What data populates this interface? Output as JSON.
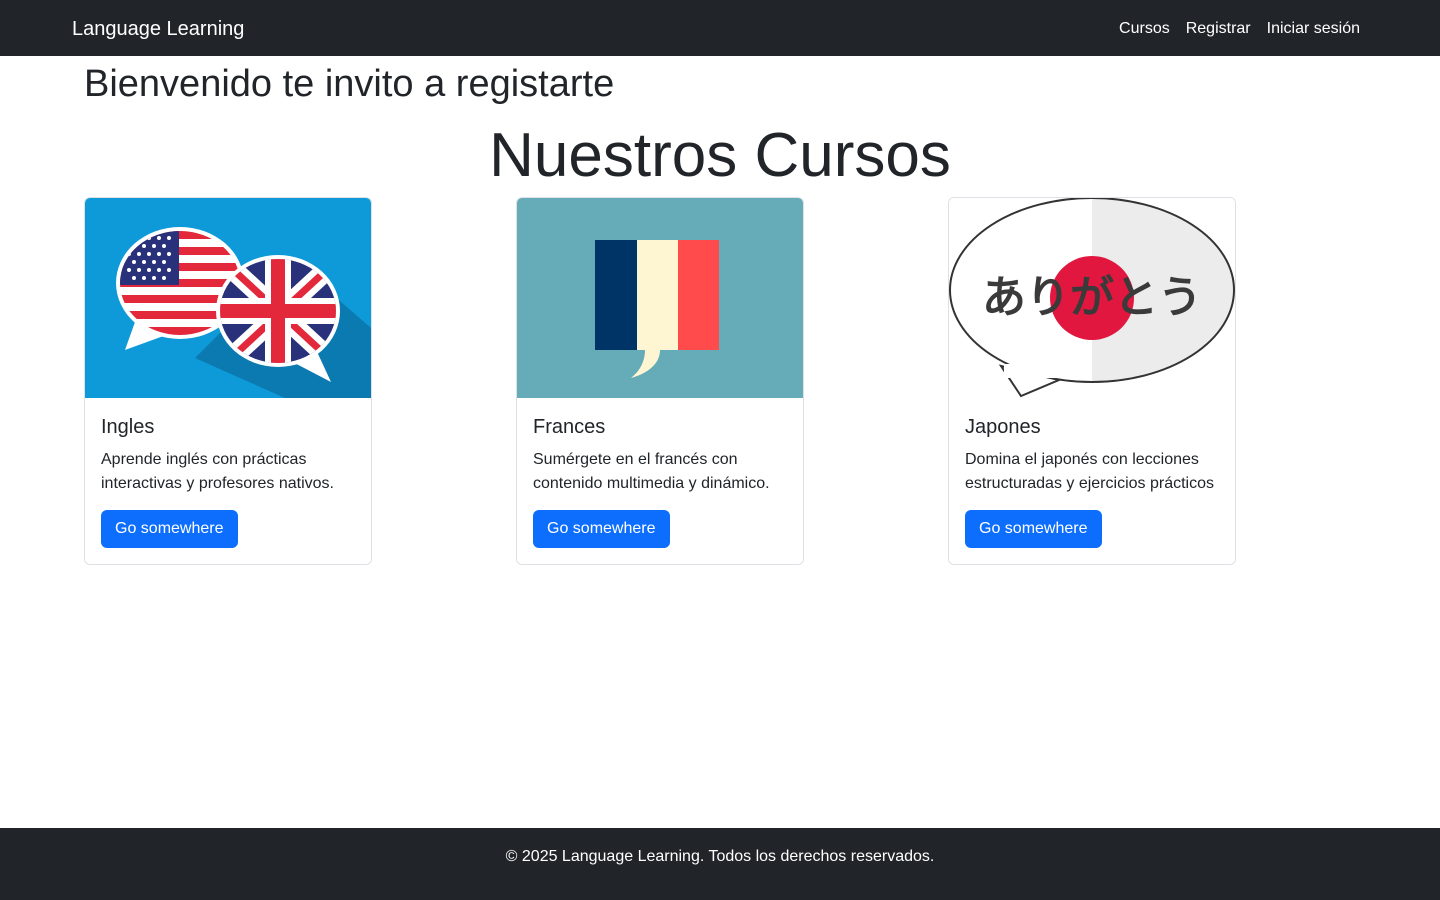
{
  "navbar": {
    "brand": "Language Learning",
    "links": [
      "Cursos",
      "Registrar",
      "Iniciar sesión"
    ]
  },
  "hero": {
    "welcome": "Bienvenido te invito a registarte",
    "section_title": "Nuestros Cursos"
  },
  "courses": [
    {
      "title": "Ingles",
      "text": "Aprende inglés con prácticas interactivas y profesores nativos.",
      "button": "Go somewhere",
      "image_icon": "us-uk-flag-speech-bubbles-icon"
    },
    {
      "title": "Frances",
      "text": "Sumérgete en el francés con contenido multimedia y dinámico.",
      "button": "Go somewhere",
      "image_icon": "french-flag-speech-bubble-icon"
    },
    {
      "title": "Japones",
      "text": "Domina el japonés con lecciones estructuradas y ejercicios prácticos",
      "button": "Go somewhere",
      "image_icon": "japanese-flag-speech-bubble-icon",
      "image_text": "ありがとう"
    }
  ],
  "footer": {
    "text": "© 2025 Language Learning. Todos los derechos reservados."
  },
  "colors": {
    "navbar_bg": "#212529",
    "primary": "#0d6efd",
    "english_bg": "#0e9ad9",
    "french_bg": "#66abb8"
  }
}
